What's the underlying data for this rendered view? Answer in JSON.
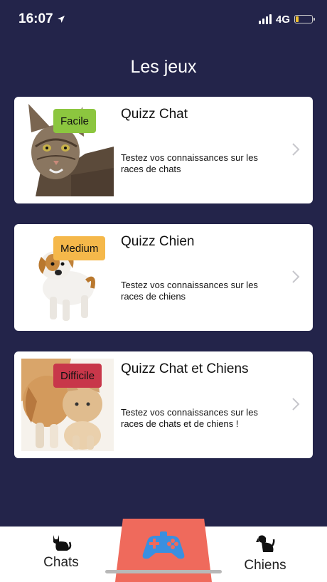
{
  "status_bar": {
    "time": "16:07",
    "network": "4G",
    "battery_color": "#f2c230",
    "battery_level": 0.2
  },
  "header": {
    "title": "Les jeux"
  },
  "games": [
    {
      "title": "Quizz Chat",
      "difficulty": "Facile",
      "badge_color": "#8cc63f",
      "description": "Testez vos connaissances sur les races de chats",
      "image": "cat-photo"
    },
    {
      "title": "Quizz Chien",
      "difficulty": "Medium",
      "badge_color": "#f5b84a",
      "description": "Testez vos connaissances sur les races de chiens",
      "image": "dog-photo"
    },
    {
      "title": "Quizz Chat et Chiens",
      "difficulty": "Difficile",
      "badge_color": "#c8374a",
      "description": "Testez vos connaissances sur les races de chats et de chiens !",
      "image": "cat-and-dog-photo"
    }
  ],
  "bottom_nav": {
    "left_label": "Chats",
    "left_icon": "cat-icon",
    "center_icon": "gamepad-icon",
    "center_color": "#ef6a5c",
    "right_label": "Chiens",
    "right_icon": "dog-icon"
  },
  "colors": {
    "background": "#23244a",
    "card": "#ffffff",
    "accent_blue": "#3a8fe0"
  }
}
